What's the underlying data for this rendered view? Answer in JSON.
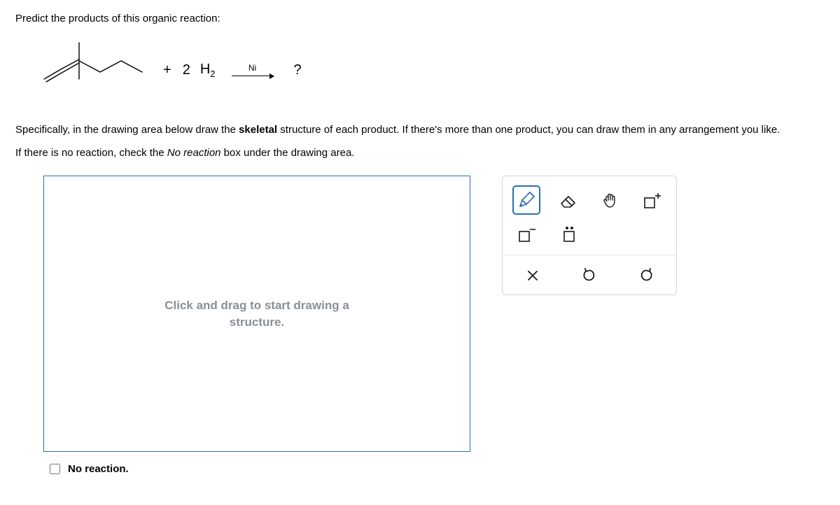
{
  "question": {
    "title": "Predict the products of this organic reaction:",
    "reactant_plus": "+",
    "coefficient": "2",
    "hydrogen": "H",
    "hydrogen_sub": "2",
    "catalyst": "Ni",
    "product_placeholder": "?"
  },
  "instructions": {
    "line1_a": "Specifically, in the drawing area below draw the ",
    "line1_b": "skeletal",
    "line1_c": " structure of each product. If there's more than one product, you can draw them in any arrangement you like.",
    "line2_a": "If there is no reaction, check the ",
    "line2_b": "No reaction",
    "line2_c": " box under the drawing area."
  },
  "canvas": {
    "hint_line1": "Click and drag to start drawing a",
    "hint_line2": "structure."
  },
  "toolbox": {
    "pencil": "pencil-icon",
    "eraser": "eraser-icon",
    "hand": "hand-icon",
    "plus_charge": "plus-charge-icon",
    "minus_charge": "minus-charge-icon",
    "lone_pair": "lone-pair-icon",
    "clear": "clear-icon",
    "undo": "undo-icon",
    "redo": "redo-icon"
  },
  "no_reaction": {
    "label": "No reaction."
  }
}
